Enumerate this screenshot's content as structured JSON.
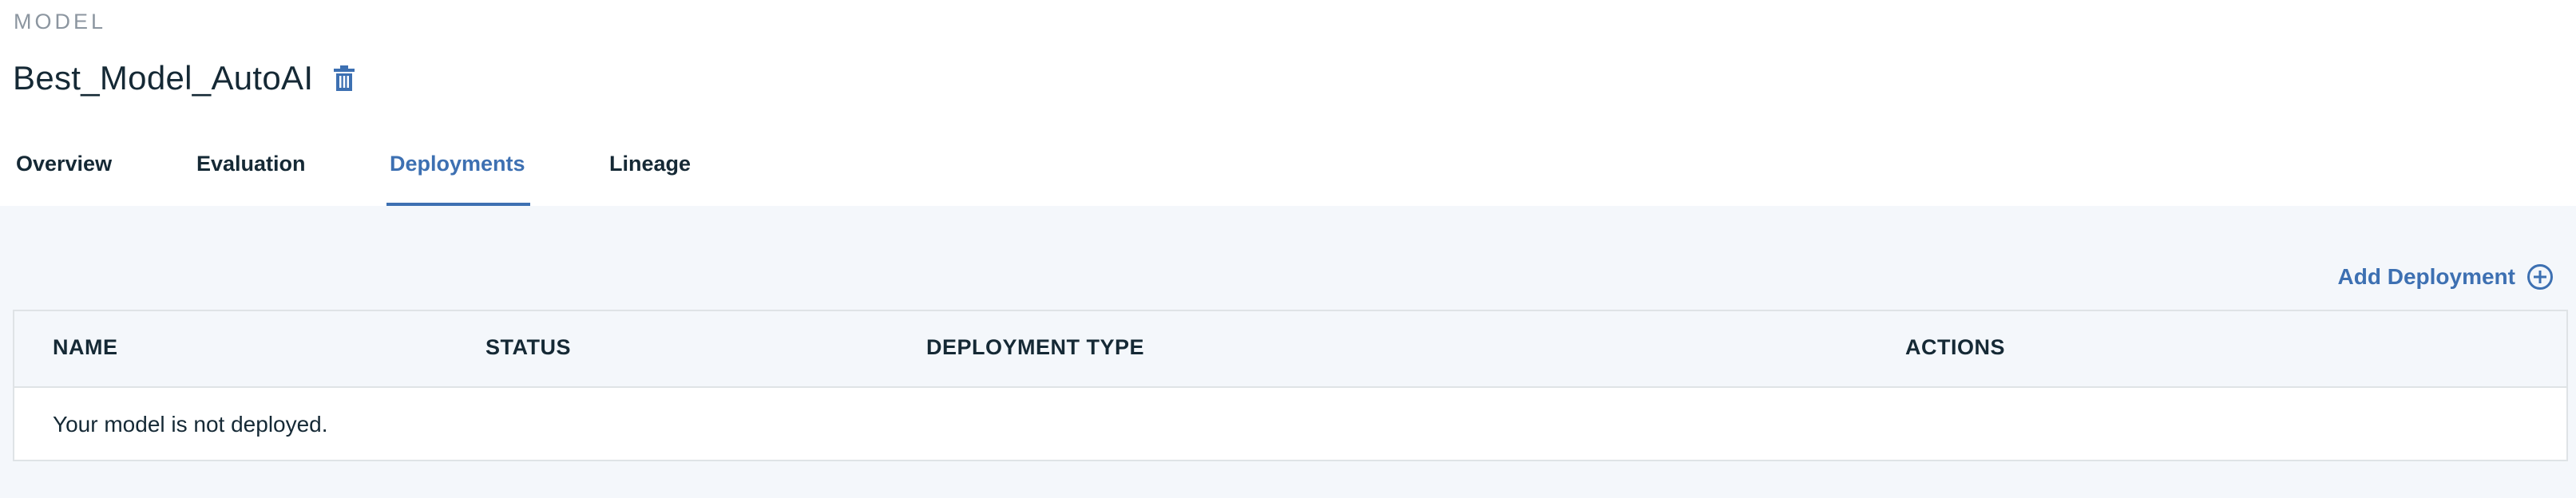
{
  "header": {
    "eyebrow": "MODEL",
    "title": "Best_Model_AutoAI"
  },
  "tabs": [
    {
      "label": "Overview",
      "active": false
    },
    {
      "label": "Evaluation",
      "active": false
    },
    {
      "label": "Deployments",
      "active": true
    },
    {
      "label": "Lineage",
      "active": false
    }
  ],
  "actions": {
    "add_deployment": "Add Deployment"
  },
  "table": {
    "columns": [
      "NAME",
      "STATUS",
      "DEPLOYMENT TYPE",
      "ACTIONS"
    ],
    "empty_message": "Your model is not deployed."
  },
  "colors": {
    "accent": "#3d70b2",
    "text": "#152935",
    "muted": "#8c96a0",
    "content_bg": "#f4f7fb",
    "border": "#dfe3e6"
  },
  "icons": {
    "delete": "trash-icon",
    "add": "add-circle-icon"
  }
}
